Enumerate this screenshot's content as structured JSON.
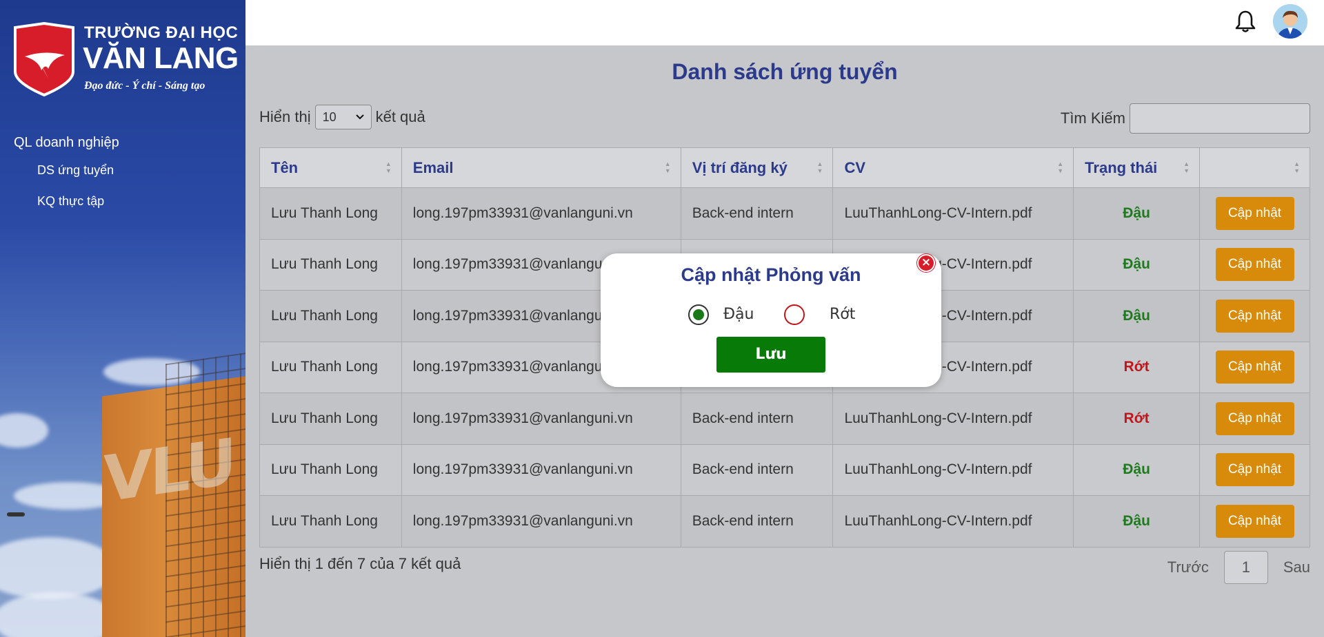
{
  "brand": {
    "line1": "TRƯỜNG ĐẠI HỌC",
    "line2": "VĂN LANG",
    "slogan": "Đạo đức - Ý chí - Sáng tạo",
    "color": "#d81d2a"
  },
  "sidebar": {
    "heading": "QL doanh nghiệp",
    "items": [
      {
        "label": "DS ứng tuyển"
      },
      {
        "label": "KQ thực tập"
      }
    ],
    "building_text": "VLU"
  },
  "topbar": {
    "icons": [
      "bell-icon",
      "avatar"
    ]
  },
  "page": {
    "title": "Danh sách ứng tuyển",
    "show_label_before": "Hiển thị",
    "show_value": "10",
    "show_label_after": "kết quả",
    "search_label": "Tìm Kiếm",
    "search_value": ""
  },
  "table": {
    "columns": [
      "Tên",
      "Email",
      "Vị trí đăng ký",
      "CV",
      "Trạng thái",
      ""
    ],
    "rows": [
      {
        "name": "Lưu Thanh Long",
        "email": "long.197pm33931@vanlanguni.vn",
        "position": "Back-end intern",
        "cv": "LuuThanhLong-CV-Intern.pdf",
        "status": "Đậu",
        "action": "Cập nhật"
      },
      {
        "name": "Lưu Thanh Long",
        "email": "long.197pm33931@vanlanguni.vn",
        "position": "Back-end intern",
        "cv": "LuuThanhLong-CV-Intern.pdf",
        "status": "Đậu",
        "action": "Cập nhật"
      },
      {
        "name": "Lưu Thanh Long",
        "email": "long.197pm33931@vanlanguni.vn",
        "position": "Back-end intern",
        "cv": "LuuThanhLong-CV-Intern.pdf",
        "status": "Đậu",
        "action": "Cập nhật"
      },
      {
        "name": "Lưu Thanh Long",
        "email": "long.197pm33931@vanlanguni.vn",
        "position": "Back-end intern",
        "cv": "LuuThanhLong-CV-Intern.pdf",
        "status": "Rớt",
        "action": "Cập nhật"
      },
      {
        "name": "Lưu Thanh Long",
        "email": "long.197pm33931@vanlanguni.vn",
        "position": "Back-end intern",
        "cv": "LuuThanhLong-CV-Intern.pdf",
        "status": "Rớt",
        "action": "Cập nhật"
      },
      {
        "name": "Lưu Thanh Long",
        "email": "long.197pm33931@vanlanguni.vn",
        "position": "Back-end intern",
        "cv": "LuuThanhLong-CV-Intern.pdf",
        "status": "Đậu",
        "action": "Cập nhật"
      },
      {
        "name": "Lưu Thanh Long",
        "email": "long.197pm33931@vanlanguni.vn",
        "position": "Back-end intern",
        "cv": "LuuThanhLong-CV-Intern.pdf",
        "status": "Đậu",
        "action": "Cập nhật"
      }
    ],
    "status_colors": {
      "Đậu": "#1f7a1f",
      "Rớt": "#c0151b"
    },
    "action_color": "#d88b0a"
  },
  "footer": {
    "info": "Hiển thị 1 đến 7 của 7 kết quả",
    "prev": "Trước",
    "page": "1",
    "next": "Sau"
  },
  "modal": {
    "title": "Cập nhật Phỏng vấn",
    "options": [
      {
        "label": "Đậu",
        "checked": true
      },
      {
        "label": "Rớt",
        "checked": false
      }
    ],
    "save_label": "Lưu",
    "save_color": "#087a08"
  }
}
